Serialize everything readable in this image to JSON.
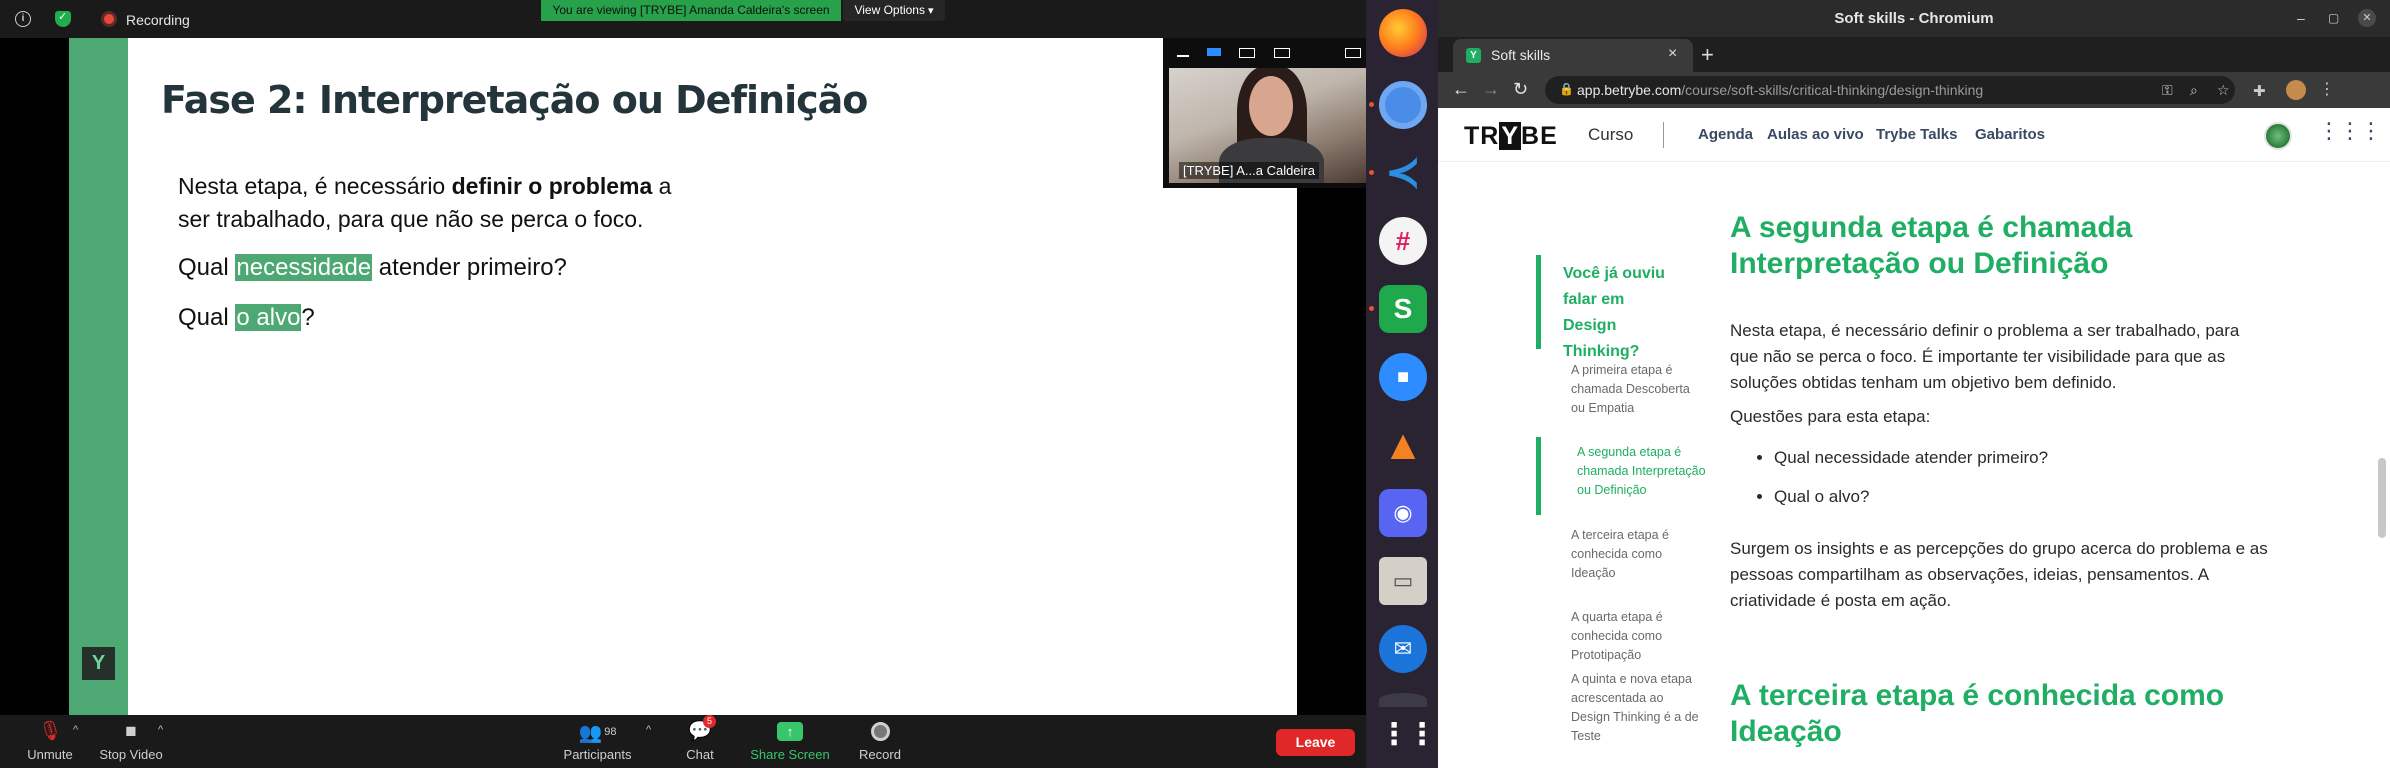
{
  "zoom": {
    "recording_label": "Recording",
    "viewing_banner": "You are viewing [TRYBE] Amanda Caldeira's screen",
    "view_options": "View Options",
    "video_name": "[TRYBE] A...a Caldeira",
    "bottom": {
      "unmute": "Unmute",
      "stop_video": "Stop Video",
      "participants": "Participants",
      "participants_count": "98",
      "chat": "Chat",
      "chat_badge": "5",
      "share_screen": "Share Screen",
      "record": "Record",
      "leave": "Leave"
    }
  },
  "slide": {
    "title": "Fase 2: Interpretação ou Definição",
    "p1_before": "Nesta etapa, é necessário ",
    "p1_bold": "definir o problema",
    "p1_after": " a ser trabalhado, para que não se perca o foco.",
    "q1_before": "Qual ",
    "q1_hl": "necessidade",
    "q1_after": " atender primeiro?",
    "q2_before": "Qual ",
    "q2_hl": "o alvo",
    "q2_after": "?",
    "logo": "Y"
  },
  "dock": {
    "apps": [
      "firefox-icon",
      "chromium-icon",
      "vscode-icon",
      "slack-icon",
      "gitkraken-icon",
      "zoom-icon",
      "vlc-icon",
      "discord-icon",
      "files-icon",
      "thunderbird-icon",
      "app-grid-icon"
    ]
  },
  "chrome": {
    "window_title": "Soft skills - Chromium",
    "tab_label": "Soft skills",
    "url_host": "app.betrybe.com",
    "url_path": "/course/soft-skills/critical-thinking/design-thinking"
  },
  "site": {
    "logo_pre": "TR",
    "logo_y": "Y",
    "logo_post": "BE",
    "curso": "Curso",
    "nav": [
      "Agenda",
      "Aulas ao vivo",
      "Trybe Talks",
      "Gabaritos"
    ]
  },
  "toc": {
    "heading": "Você já ouviu falar em Design Thinking?",
    "items": [
      "A primeira etapa é chamada Descoberta ou Empatia",
      "A segunda etapa é chamada Interpretação ou Definição",
      "A terceira etapa é conhecida como Ideação",
      "A quarta etapa é conhecida como Prototipação",
      "A quinta e nova etapa acrescentada ao Design Thinking é a de Teste"
    ]
  },
  "article": {
    "h2a": "A segunda etapa é chamada Interpretação ou Definição",
    "p1": "Nesta etapa, é necessário definir o problema a ser trabalhado, para que não se perca o foco. É importante ter visibilidade para que as soluções obtidas tenham um objetivo bem definido.",
    "p2": "Questões para esta etapa:",
    "list": [
      "Qual necessidade atender primeiro?",
      "Qual o alvo?"
    ],
    "p3": "Surgem os insights e as percepções do grupo acerca do problema e as pessoas compartilham as observações, ideias, pensamentos. A criatividade é posta em ação.",
    "h2b": "A terceira etapa é conhecida como Ideação"
  }
}
